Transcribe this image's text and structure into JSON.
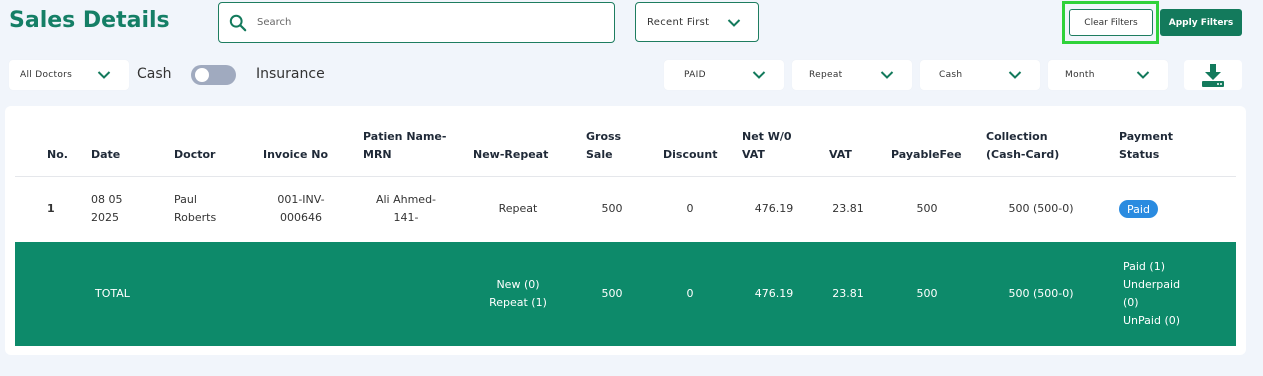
{
  "header": {
    "title": "Sales Details",
    "search_placeholder": "Search",
    "sort_label": "Recent First",
    "clear_filters": "Clear Filters",
    "apply_filters": "Apply Filters"
  },
  "filters": {
    "doctor": "All Doctors",
    "cash_label": "Cash",
    "insurance_label": "Insurance",
    "payment_status": "PAID",
    "visit_type": "Repeat",
    "payment_mode": "Cash",
    "period": "Month"
  },
  "table": {
    "headers": {
      "no": "No.",
      "date": "Date",
      "doctor": "Doctor",
      "invoice": "Invoice No",
      "patient_1": "Patien Name-",
      "patient_2": "MRN",
      "new_repeat": "New-Repeat",
      "gross_1": "Gross",
      "gross_2": "Sale",
      "discount": "Discount",
      "net_1": "Net W/0",
      "net_2": "VAT",
      "vat": "VAT",
      "payable": "PayableFee",
      "collection_1": "Collection",
      "collection_2": "(Cash-Card)",
      "status_1": "Payment",
      "status_2": "Status"
    },
    "rows": [
      {
        "no": "1",
        "date_1": "08 05",
        "date_2": "2025",
        "doctor_1": "Paul",
        "doctor_2": "Roberts",
        "invoice_1": "001-INV-",
        "invoice_2": "000646",
        "patient_1": "Ali Ahmed-",
        "patient_2": "141-",
        "new_repeat": "Repeat",
        "gross": "500",
        "discount": "0",
        "net": "476.19",
        "vat": "23.81",
        "payable": "500",
        "collection": "500 (500-0)",
        "status": "Paid"
      }
    ],
    "total": {
      "label": "TOTAL",
      "new": "New (0)",
      "repeat": "Repeat (1)",
      "gross": "500",
      "discount": "0",
      "net": "476.19",
      "vat": "23.81",
      "payable": "500",
      "collection": "500 (500-0)",
      "paid": "Paid (1)",
      "underpaid_1": "Underpaid",
      "underpaid_2": "(0)",
      "unpaid": "UnPaid (0)"
    }
  },
  "colors": {
    "brand": "#157f66",
    "total_bar": "#0d8a6a",
    "paid_badge": "#2a8be0",
    "highlight": "#2fd23a"
  }
}
